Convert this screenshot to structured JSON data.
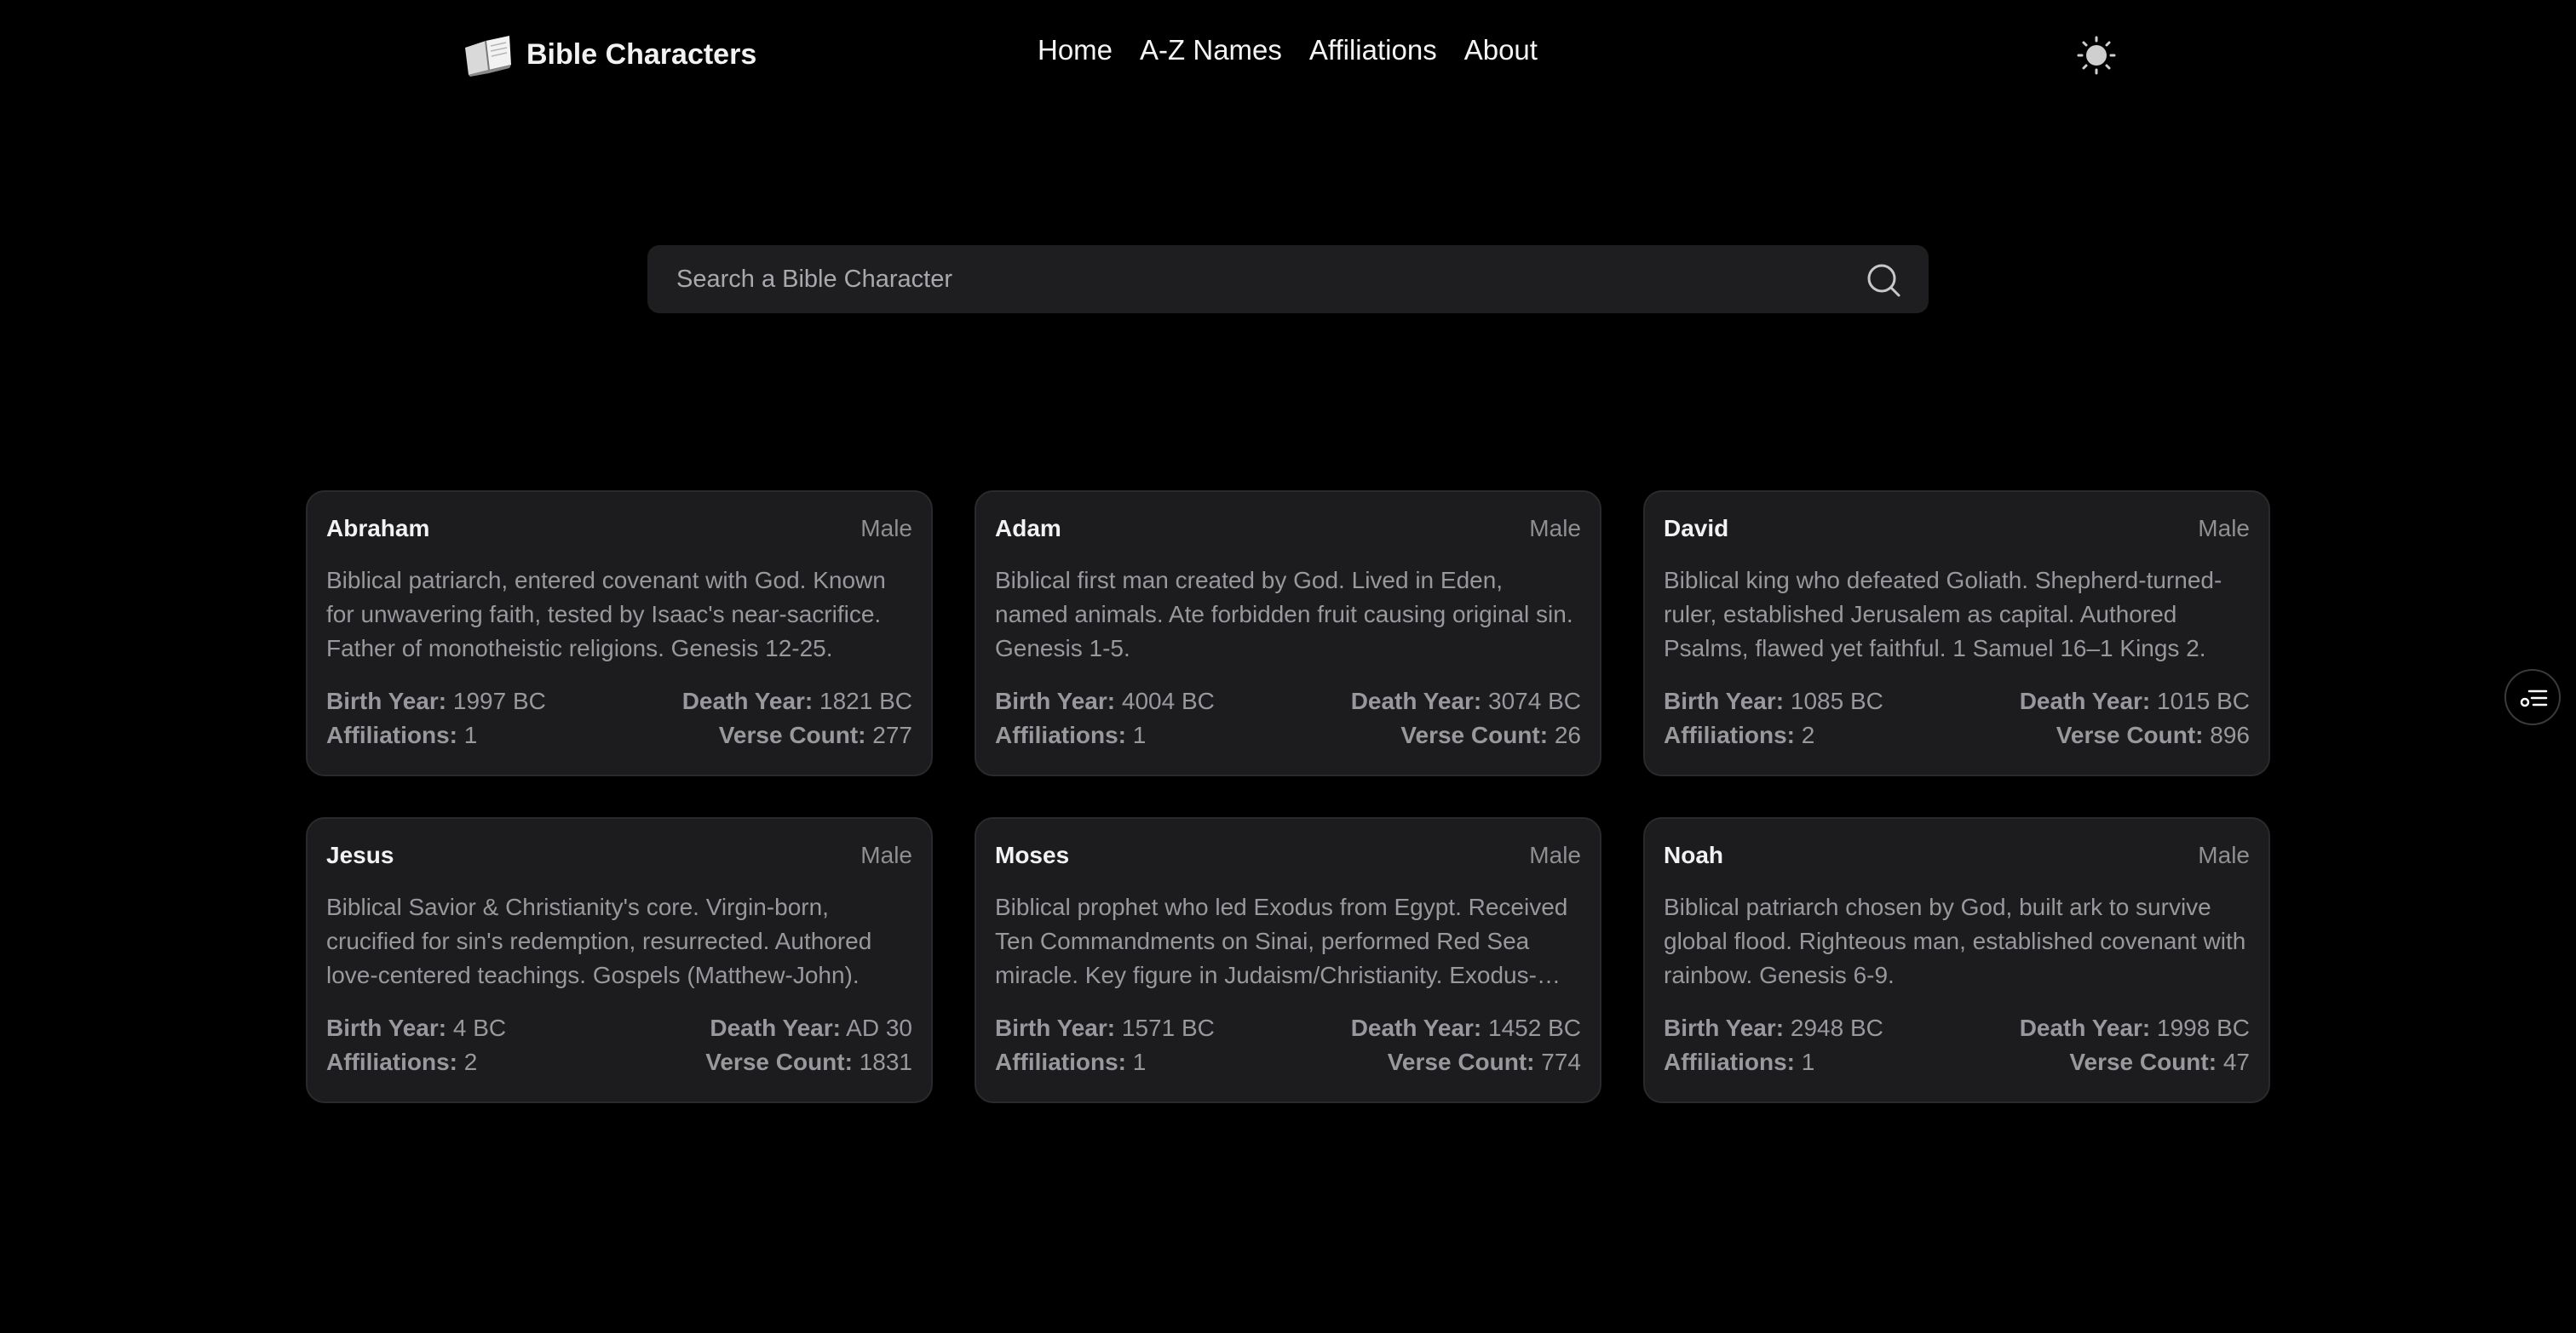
{
  "nav": {
    "brand": "Bible Characters",
    "brand_icon": "open-bible-icon",
    "links": [
      "Home",
      "A-Z Names",
      "Affiliations",
      "About"
    ],
    "theme_icon": "sun-icon"
  },
  "search": {
    "placeholder": "Search a Bible Character",
    "icon": "search-icon"
  },
  "labels": {
    "birth": "Birth Year:",
    "death": "Death Year:",
    "affiliations": "Affiliations:",
    "verses": "Verse Count:"
  },
  "characters": [
    {
      "name": "Abraham",
      "gender": "Male",
      "description": "Biblical patriarch, entered covenant with God. Known for unwavering faith, tested by Isaac's near-sacrifice. Father of monotheistic religions. Genesis 12-25.",
      "birth": "1997 BC",
      "death": "1821 BC",
      "affiliations": "1",
      "verses": "277"
    },
    {
      "name": "Adam",
      "gender": "Male",
      "description": "Biblical first man created by God. Lived in Eden, named animals. Ate forbidden fruit causing original sin. Genesis 1-5.",
      "birth": "4004 BC",
      "death": "3074 BC",
      "affiliations": "1",
      "verses": "26"
    },
    {
      "name": "David",
      "gender": "Male",
      "description": "Biblical king who defeated Goliath. Shepherd-turned-ruler, established Jerusalem as capital. Authored Psalms, flawed yet faithful. 1 Samuel 16–1 Kings 2.",
      "birth": "1085 BC",
      "death": "1015 BC",
      "affiliations": "2",
      "verses": "896"
    },
    {
      "name": "Jesus",
      "gender": "Male",
      "description": "Biblical Savior & Christianity's core. Virgin-born, crucified for sin's redemption, resurrected. Authored love-centered teachings. Gospels (Matthew-John).",
      "birth": "4 BC",
      "death": "AD 30",
      "affiliations": "2",
      "verses": "1831"
    },
    {
      "name": "Moses",
      "gender": "Male",
      "description": "Biblical prophet who led Exodus from Egypt. Received Ten Commandments on Sinai, performed Red Sea miracle. Key figure in Judaism/Christianity. Exodus-Deuteronomy.",
      "birth": "1571 BC",
      "death": "1452 BC",
      "affiliations": "1",
      "verses": "774"
    },
    {
      "name": "Noah",
      "gender": "Male",
      "description": "Biblical patriarch chosen by God, built ark to survive global flood. Righteous man, established covenant with rainbow. Genesis 6-9.",
      "birth": "2948 BC",
      "death": "1998 BC",
      "affiliations": "1",
      "verses": "47"
    }
  ],
  "filter_icon": "filter-list-icon",
  "colors": {
    "background": "#000000",
    "card": "#1c1c1e",
    "muted_text": "#98989d"
  }
}
